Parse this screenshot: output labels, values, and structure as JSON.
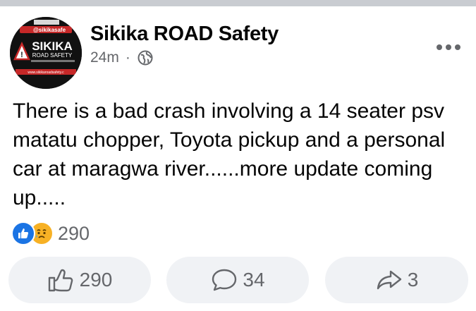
{
  "post": {
    "page_name": "Sikika ROAD Safety",
    "time": "24m",
    "separator": "·",
    "privacy_icon": "globe-icon",
    "more_icon": "more-horizontal-icon",
    "text": "There is a bad crash involving a 14 seater psv matatu chopper, Toyota pickup and a personal car at  maragwa river......more update coming up.....",
    "avatar": {
      "handle": "@sikikasafe",
      "brand_main": "SIKIKA",
      "brand_sub": "ROAD SAFETY",
      "website": "www.sikikaroadsafety.c"
    }
  },
  "reactions": {
    "icons": [
      "like-reaction-icon",
      "sad-reaction-icon"
    ],
    "count": "290"
  },
  "actions": {
    "like": {
      "icon": "thumbs-up-icon",
      "count": "290"
    },
    "comment": {
      "icon": "comment-icon",
      "count": "34"
    },
    "share": {
      "icon": "share-icon",
      "count": "3"
    }
  },
  "colors": {
    "like_blue": "#1b74e4",
    "sad_yellow": "#f7b125",
    "secondary_text": "#65676b",
    "button_bg": "#f0f2f5"
  }
}
